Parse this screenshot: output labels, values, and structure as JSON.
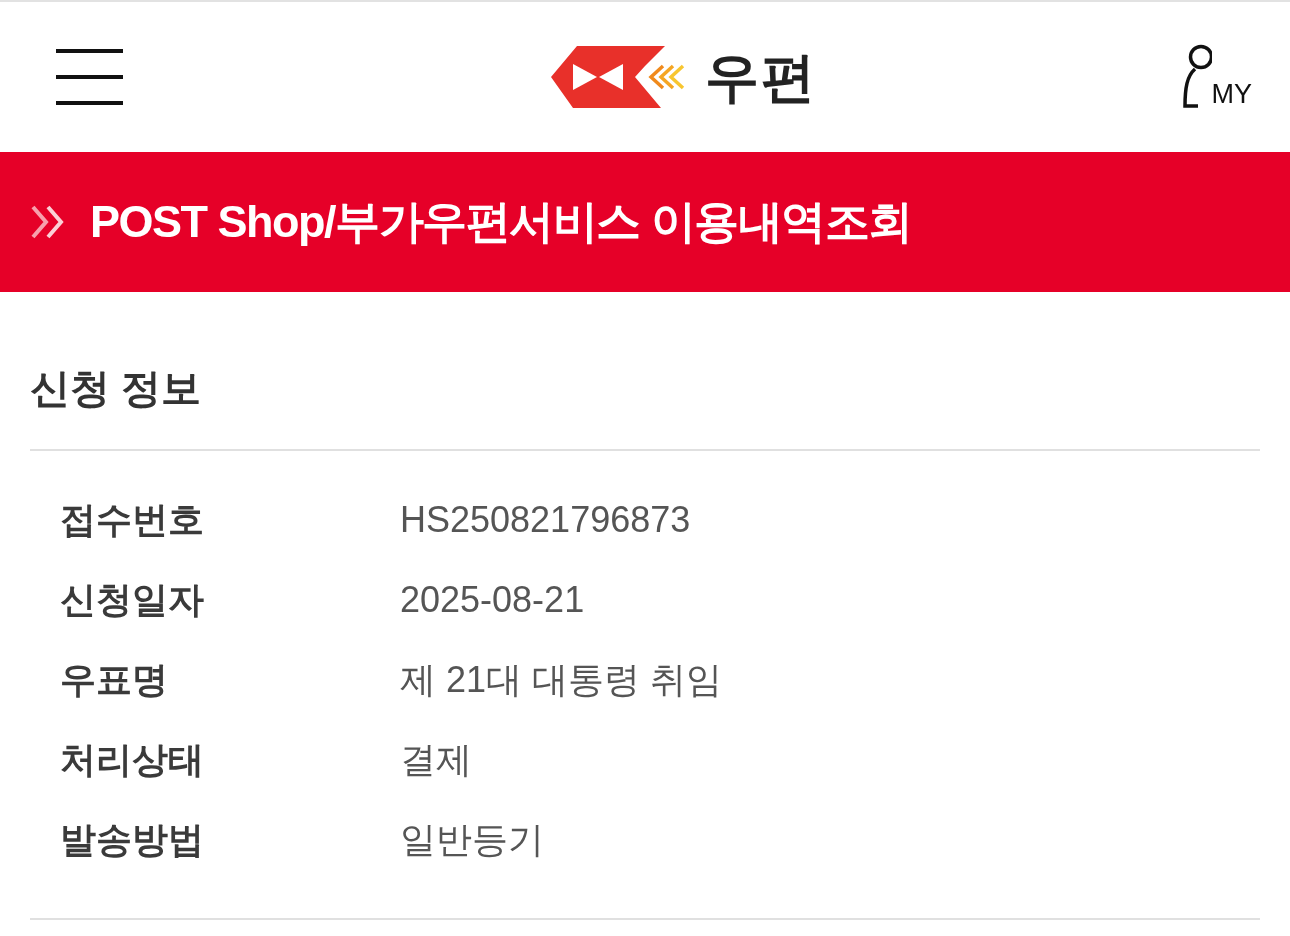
{
  "header": {
    "logo_text": "우편",
    "my_label": "MY"
  },
  "banner": {
    "title": "POST Shop/부가우편서비스 이용내역조회"
  },
  "section": {
    "title": "신청 정보",
    "rows": [
      {
        "label": "접수번호",
        "value": "HS250821796873"
      },
      {
        "label": "신청일자",
        "value": "2025-08-21"
      },
      {
        "label": "우표명",
        "value": "제 21대 대통령 취임"
      },
      {
        "label": "처리상태",
        "value": "결제"
      },
      {
        "label": "발송방법",
        "value": "일반등기"
      }
    ]
  }
}
